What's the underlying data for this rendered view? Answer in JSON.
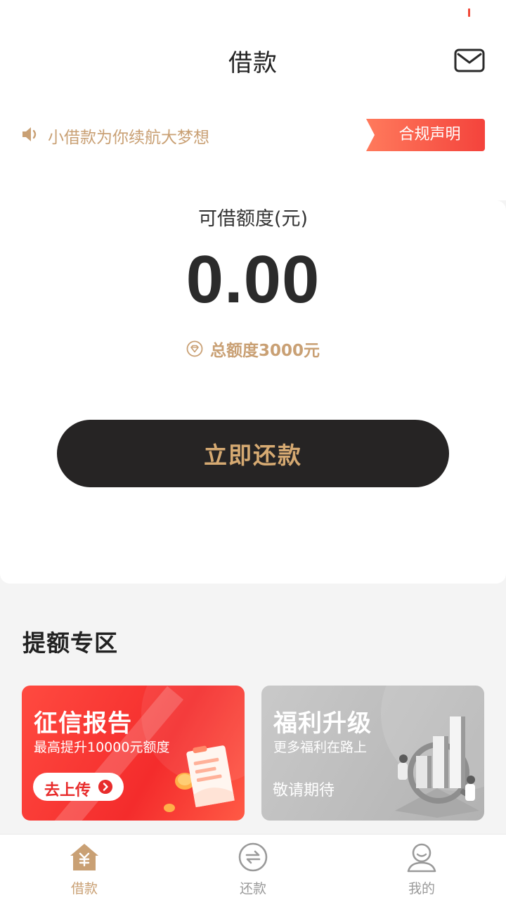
{
  "header": {
    "title": "借款"
  },
  "notice": {
    "text": "小借款为你续航大梦想",
    "compliance_label": "合规声明"
  },
  "credit": {
    "label": "可借额度(元)",
    "amount": "0.00",
    "total_text": "总额度3000元",
    "action_label": "立即还款"
  },
  "boost": {
    "section_title": "提额专区",
    "cards": [
      {
        "title": "征信报告",
        "subtitle": "最高提升10000元额度",
        "action_label": "去上传",
        "color": "#f42c2c"
      },
      {
        "title": "福利升级",
        "subtitle": "更多福利在路上",
        "status": "敬请期待",
        "color": "#bdbdbd"
      }
    ]
  },
  "tabs": [
    {
      "label": "借款",
      "icon": "home-yuan-icon",
      "active": true
    },
    {
      "label": "还款",
      "icon": "repay-exchange-icon",
      "active": false
    },
    {
      "label": "我的",
      "icon": "user-icon",
      "active": false
    }
  ],
  "colors": {
    "accent_gold": "#c9a074",
    "accent_red": "#f4433c",
    "button_dark": "#262424"
  }
}
